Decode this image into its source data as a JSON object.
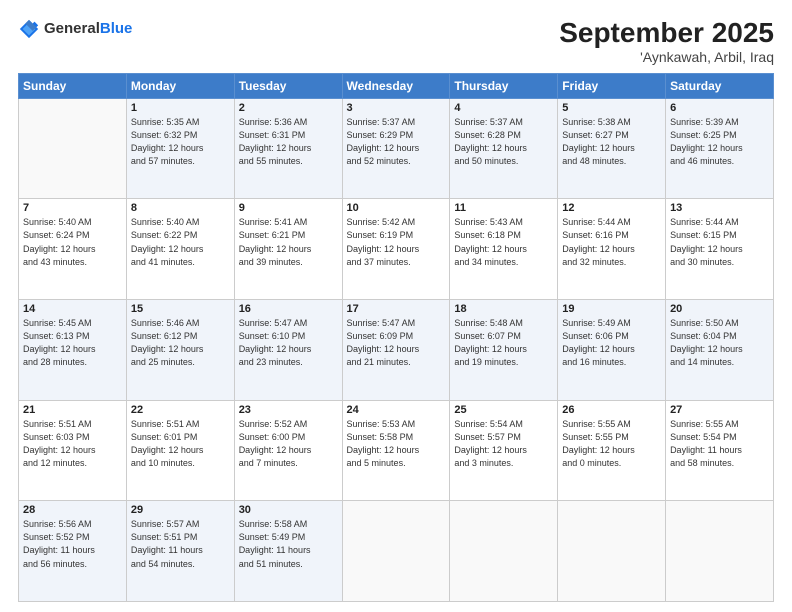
{
  "logo": {
    "general": "General",
    "blue": "Blue"
  },
  "title": "September 2025",
  "subtitle": "'Aynkawah, Arbil, Iraq",
  "headers": [
    "Sunday",
    "Monday",
    "Tuesday",
    "Wednesday",
    "Thursday",
    "Friday",
    "Saturday"
  ],
  "rows": [
    [
      {
        "day": "",
        "info": ""
      },
      {
        "day": "1",
        "info": "Sunrise: 5:35 AM\nSunset: 6:32 PM\nDaylight: 12 hours\nand 57 minutes."
      },
      {
        "day": "2",
        "info": "Sunrise: 5:36 AM\nSunset: 6:31 PM\nDaylight: 12 hours\nand 55 minutes."
      },
      {
        "day": "3",
        "info": "Sunrise: 5:37 AM\nSunset: 6:29 PM\nDaylight: 12 hours\nand 52 minutes."
      },
      {
        "day": "4",
        "info": "Sunrise: 5:37 AM\nSunset: 6:28 PM\nDaylight: 12 hours\nand 50 minutes."
      },
      {
        "day": "5",
        "info": "Sunrise: 5:38 AM\nSunset: 6:27 PM\nDaylight: 12 hours\nand 48 minutes."
      },
      {
        "day": "6",
        "info": "Sunrise: 5:39 AM\nSunset: 6:25 PM\nDaylight: 12 hours\nand 46 minutes."
      }
    ],
    [
      {
        "day": "7",
        "info": "Sunrise: 5:40 AM\nSunset: 6:24 PM\nDaylight: 12 hours\nand 43 minutes."
      },
      {
        "day": "8",
        "info": "Sunrise: 5:40 AM\nSunset: 6:22 PM\nDaylight: 12 hours\nand 41 minutes."
      },
      {
        "day": "9",
        "info": "Sunrise: 5:41 AM\nSunset: 6:21 PM\nDaylight: 12 hours\nand 39 minutes."
      },
      {
        "day": "10",
        "info": "Sunrise: 5:42 AM\nSunset: 6:19 PM\nDaylight: 12 hours\nand 37 minutes."
      },
      {
        "day": "11",
        "info": "Sunrise: 5:43 AM\nSunset: 6:18 PM\nDaylight: 12 hours\nand 34 minutes."
      },
      {
        "day": "12",
        "info": "Sunrise: 5:44 AM\nSunset: 6:16 PM\nDaylight: 12 hours\nand 32 minutes."
      },
      {
        "day": "13",
        "info": "Sunrise: 5:44 AM\nSunset: 6:15 PM\nDaylight: 12 hours\nand 30 minutes."
      }
    ],
    [
      {
        "day": "14",
        "info": "Sunrise: 5:45 AM\nSunset: 6:13 PM\nDaylight: 12 hours\nand 28 minutes."
      },
      {
        "day": "15",
        "info": "Sunrise: 5:46 AM\nSunset: 6:12 PM\nDaylight: 12 hours\nand 25 minutes."
      },
      {
        "day": "16",
        "info": "Sunrise: 5:47 AM\nSunset: 6:10 PM\nDaylight: 12 hours\nand 23 minutes."
      },
      {
        "day": "17",
        "info": "Sunrise: 5:47 AM\nSunset: 6:09 PM\nDaylight: 12 hours\nand 21 minutes."
      },
      {
        "day": "18",
        "info": "Sunrise: 5:48 AM\nSunset: 6:07 PM\nDaylight: 12 hours\nand 19 minutes."
      },
      {
        "day": "19",
        "info": "Sunrise: 5:49 AM\nSunset: 6:06 PM\nDaylight: 12 hours\nand 16 minutes."
      },
      {
        "day": "20",
        "info": "Sunrise: 5:50 AM\nSunset: 6:04 PM\nDaylight: 12 hours\nand 14 minutes."
      }
    ],
    [
      {
        "day": "21",
        "info": "Sunrise: 5:51 AM\nSunset: 6:03 PM\nDaylight: 12 hours\nand 12 minutes."
      },
      {
        "day": "22",
        "info": "Sunrise: 5:51 AM\nSunset: 6:01 PM\nDaylight: 12 hours\nand 10 minutes."
      },
      {
        "day": "23",
        "info": "Sunrise: 5:52 AM\nSunset: 6:00 PM\nDaylight: 12 hours\nand 7 minutes."
      },
      {
        "day": "24",
        "info": "Sunrise: 5:53 AM\nSunset: 5:58 PM\nDaylight: 12 hours\nand 5 minutes."
      },
      {
        "day": "25",
        "info": "Sunrise: 5:54 AM\nSunset: 5:57 PM\nDaylight: 12 hours\nand 3 minutes."
      },
      {
        "day": "26",
        "info": "Sunrise: 5:55 AM\nSunset: 5:55 PM\nDaylight: 12 hours\nand 0 minutes."
      },
      {
        "day": "27",
        "info": "Sunrise: 5:55 AM\nSunset: 5:54 PM\nDaylight: 11 hours\nand 58 minutes."
      }
    ],
    [
      {
        "day": "28",
        "info": "Sunrise: 5:56 AM\nSunset: 5:52 PM\nDaylight: 11 hours\nand 56 minutes."
      },
      {
        "day": "29",
        "info": "Sunrise: 5:57 AM\nSunset: 5:51 PM\nDaylight: 11 hours\nand 54 minutes."
      },
      {
        "day": "30",
        "info": "Sunrise: 5:58 AM\nSunset: 5:49 PM\nDaylight: 11 hours\nand 51 minutes."
      },
      {
        "day": "",
        "info": ""
      },
      {
        "day": "",
        "info": ""
      },
      {
        "day": "",
        "info": ""
      },
      {
        "day": "",
        "info": ""
      }
    ]
  ]
}
